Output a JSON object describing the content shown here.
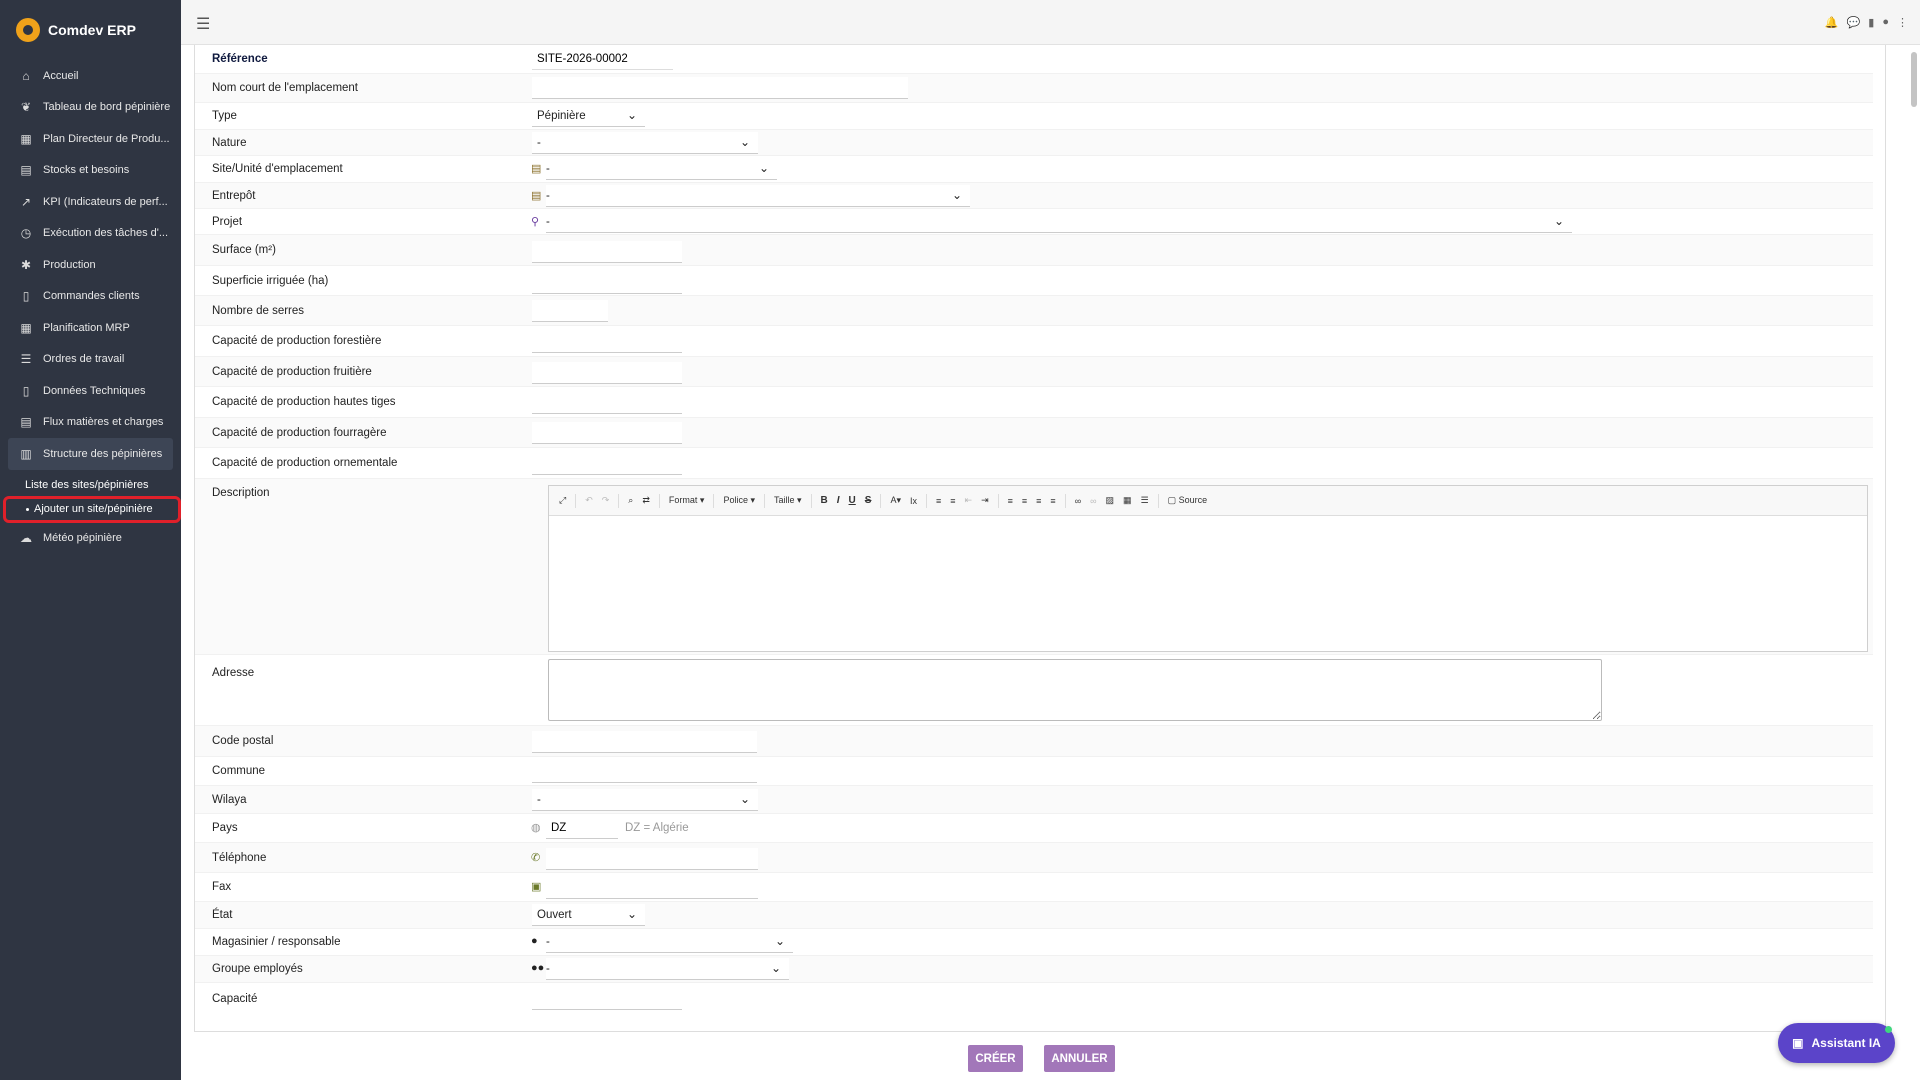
{
  "app": {
    "name": "Comdev ERP"
  },
  "sidebar": {
    "items": [
      {
        "label": "Accueil",
        "icon": "home-icon"
      },
      {
        "label": "Tableau de bord pépinière",
        "icon": "leaf-icon"
      },
      {
        "label": "Plan Directeur de Produ...",
        "icon": "calendar-icon"
      },
      {
        "label": "Stocks et besoins",
        "icon": "boxes-icon"
      },
      {
        "label": "KPI (Indicateurs de perf...",
        "icon": "chart-icon"
      },
      {
        "label": "Exécution des tâches d'...",
        "icon": "clock-icon"
      },
      {
        "label": "Production",
        "icon": "cogs-icon"
      },
      {
        "label": "Commandes clients",
        "icon": "file-icon"
      },
      {
        "label": "Planification MRP",
        "icon": "calendar-icon"
      },
      {
        "label": "Ordres de travail",
        "icon": "list-icon"
      },
      {
        "label": "Données Techniques",
        "icon": "file-icon"
      },
      {
        "label": "Flux matières et charges",
        "icon": "boxes-icon"
      },
      {
        "label": "Structure des pépinières",
        "icon": "building-icon"
      }
    ],
    "sub_items": [
      {
        "label": "Liste des sites/pépinières"
      },
      {
        "label": "Ajouter un site/pépinière"
      }
    ],
    "after": {
      "label": "Météo pépinière",
      "icon": "cloud-icon"
    }
  },
  "form": {
    "reference": {
      "label": "Référence",
      "value": "SITE-2026-00002"
    },
    "short_name": {
      "label": "Nom court de l'emplacement",
      "value": ""
    },
    "type": {
      "label": "Type",
      "value": "Pépinière"
    },
    "nature": {
      "label": "Nature",
      "value": "-"
    },
    "site_unit": {
      "label": "Site/Unité d'emplacement",
      "value": "-"
    },
    "warehouse": {
      "label": "Entrepôt",
      "value": "-"
    },
    "project": {
      "label": "Projet",
      "value": "-"
    },
    "surface": {
      "label": "Surface (m²)",
      "value": ""
    },
    "irrigated": {
      "label": "Superficie irriguée (ha)",
      "value": ""
    },
    "greenhouses": {
      "label": "Nombre de serres",
      "value": ""
    },
    "cap_forest": {
      "label": "Capacité de production forestière",
      "value": ""
    },
    "cap_fruit": {
      "label": "Capacité de production fruitière",
      "value": ""
    },
    "cap_tall": {
      "label": "Capacité de production hautes tiges",
      "value": ""
    },
    "cap_fodder": {
      "label": "Capacité de production fourragère",
      "value": ""
    },
    "cap_ornamental": {
      "label": "Capacité de production ornementale",
      "value": ""
    },
    "description": {
      "label": "Description"
    },
    "address": {
      "label": "Adresse",
      "value": ""
    },
    "postal_code": {
      "label": "Code postal",
      "value": ""
    },
    "commune": {
      "label": "Commune",
      "value": ""
    },
    "wilaya": {
      "label": "Wilaya",
      "value": "-"
    },
    "country": {
      "label": "Pays",
      "value": "DZ",
      "hint": "DZ = Algérie"
    },
    "phone": {
      "label": "Téléphone",
      "value": ""
    },
    "fax": {
      "label": "Fax",
      "value": ""
    },
    "state": {
      "label": "État",
      "value": "Ouvert"
    },
    "storekeeper": {
      "label": "Magasinier / responsable",
      "value": "-"
    },
    "employee_group": {
      "label": "Groupe employés",
      "value": "-"
    },
    "capacity": {
      "label": "Capacité",
      "value": ""
    }
  },
  "editor_toolbar": {
    "format": "Format",
    "font": "Police",
    "size": "Taille",
    "source": "Source"
  },
  "actions": {
    "create": "CRÉER",
    "cancel": "ANNULER",
    "assistant": "Assistant IA"
  }
}
